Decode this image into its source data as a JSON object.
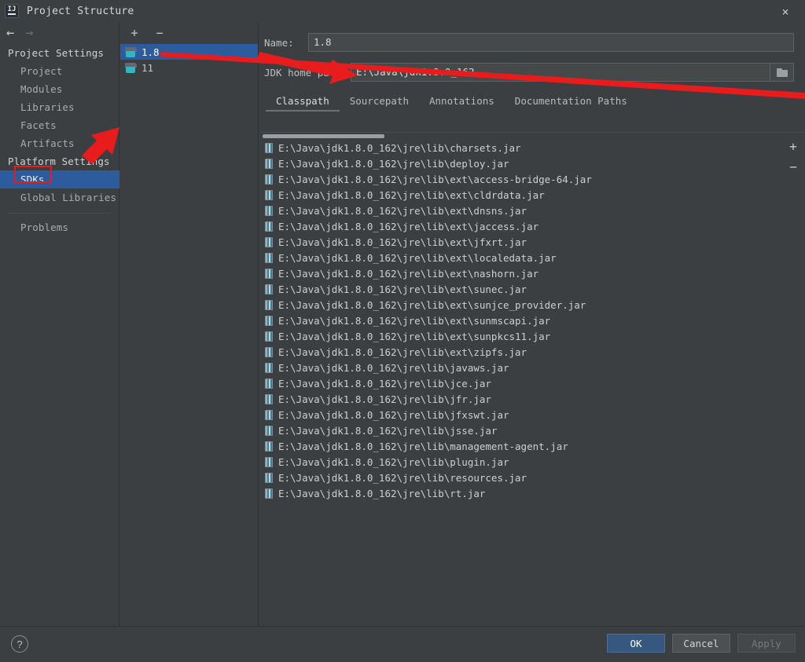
{
  "window": {
    "title": "Project Structure",
    "logo_icon": "intellij-idea-icon",
    "close_icon": "×"
  },
  "nav": {
    "back_icon": "←",
    "forward_icon": "→"
  },
  "sidebar": {
    "groups": [
      {
        "label": "Project Settings",
        "items": [
          {
            "label": "Project",
            "selected": false
          },
          {
            "label": "Modules",
            "selected": false
          },
          {
            "label": "Libraries",
            "selected": false
          },
          {
            "label": "Facets",
            "selected": false
          },
          {
            "label": "Artifacts",
            "selected": false
          }
        ]
      },
      {
        "label": "Platform Settings",
        "items": [
          {
            "label": "SDKs",
            "selected": true
          },
          {
            "label": "Global Libraries",
            "selected": false
          }
        ]
      }
    ],
    "problems": {
      "label": "Problems"
    }
  },
  "sdk_panel": {
    "add_label": "+",
    "remove_label": "−",
    "items": [
      {
        "label": "1.8",
        "selected": true
      },
      {
        "label": "11",
        "selected": false
      }
    ]
  },
  "form": {
    "name_label": "Name:",
    "name_value": "1.8",
    "jdk_home_label": "JDK home pa ...",
    "jdk_home_value": "E:\\Java\\jdk1.8.0_162",
    "browse_icon": "folder-icon"
  },
  "tabs": [
    {
      "label": "Classpath",
      "active": true
    },
    {
      "label": "Sourcepath",
      "active": false
    },
    {
      "label": "Annotations",
      "active": false
    },
    {
      "label": "Documentation Paths",
      "active": false
    }
  ],
  "classpath": {
    "add_label": "+",
    "remove_label": "−",
    "entries": [
      "E:\\Java\\jdk1.8.0_162\\jre\\lib\\charsets.jar",
      "E:\\Java\\jdk1.8.0_162\\jre\\lib\\deploy.jar",
      "E:\\Java\\jdk1.8.0_162\\jre\\lib\\ext\\access-bridge-64.jar",
      "E:\\Java\\jdk1.8.0_162\\jre\\lib\\ext\\cldrdata.jar",
      "E:\\Java\\jdk1.8.0_162\\jre\\lib\\ext\\dnsns.jar",
      "E:\\Java\\jdk1.8.0_162\\jre\\lib\\ext\\jaccess.jar",
      "E:\\Java\\jdk1.8.0_162\\jre\\lib\\ext\\jfxrt.jar",
      "E:\\Java\\jdk1.8.0_162\\jre\\lib\\ext\\localedata.jar",
      "E:\\Java\\jdk1.8.0_162\\jre\\lib\\ext\\nashorn.jar",
      "E:\\Java\\jdk1.8.0_162\\jre\\lib\\ext\\sunec.jar",
      "E:\\Java\\jdk1.8.0_162\\jre\\lib\\ext\\sunjce_provider.jar",
      "E:\\Java\\jdk1.8.0_162\\jre\\lib\\ext\\sunmscapi.jar",
      "E:\\Java\\jdk1.8.0_162\\jre\\lib\\ext\\sunpkcs11.jar",
      "E:\\Java\\jdk1.8.0_162\\jre\\lib\\ext\\zipfs.jar",
      "E:\\Java\\jdk1.8.0_162\\jre\\lib\\javaws.jar",
      "E:\\Java\\jdk1.8.0_162\\jre\\lib\\jce.jar",
      "E:\\Java\\jdk1.8.0_162\\jre\\lib\\jfr.jar",
      "E:\\Java\\jdk1.8.0_162\\jre\\lib\\jfxswt.jar",
      "E:\\Java\\jdk1.8.0_162\\jre\\lib\\jsse.jar",
      "E:\\Java\\jdk1.8.0_162\\jre\\lib\\management-agent.jar",
      "E:\\Java\\jdk1.8.0_162\\jre\\lib\\plugin.jar",
      "E:\\Java\\jdk1.8.0_162\\jre\\lib\\resources.jar",
      "E:\\Java\\jdk1.8.0_162\\jre\\lib\\rt.jar"
    ]
  },
  "footer": {
    "help_label": "?",
    "ok_label": "OK",
    "cancel_label": "Cancel",
    "apply_label": "Apply"
  },
  "annotations": {
    "highlight_color": "#e81c1c",
    "shapes": [
      "arrow-to-sdks",
      "arrow-to-jdk-home-path",
      "rect-around-sdks"
    ]
  },
  "colors": {
    "background": "#3c3f41",
    "selection_blue": "#2d5c9e",
    "primary_button": "#365880",
    "annotation_red": "#e81c1c"
  }
}
